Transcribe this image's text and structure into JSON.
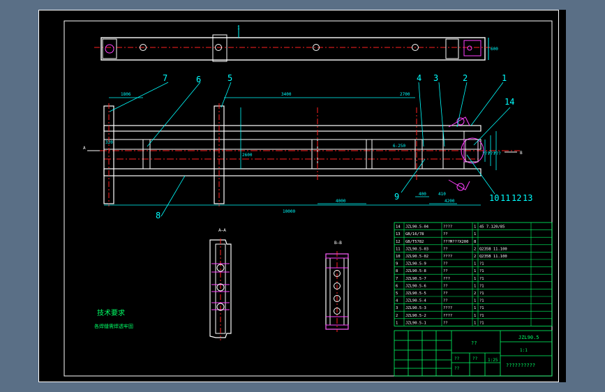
{
  "callouts": [
    "1",
    "2",
    "3",
    "4",
    "5",
    "6",
    "7",
    "8",
    "9",
    "10",
    "11",
    "12",
    "13",
    "14"
  ],
  "dimensions": {
    "top_view": "1",
    "side_height": "600",
    "dim_1806": "1806",
    "dim_3400": "3400",
    "dim_2700": "2700",
    "dim_2600": "2600",
    "dim_10000": "10000",
    "dim_4000": "4000",
    "dim_400": "400",
    "dim_410": "410",
    "dim_4200": "4200",
    "note_6_250": "6-250",
    "mark_320": "320",
    "right_dims": [
      "???",
      "???",
      "???"
    ]
  },
  "views": {
    "section_a": "A—A",
    "section_b": "B—B",
    "arrow_a": "A",
    "arrow_b": "B"
  },
  "notes": {
    "title": "技术要求",
    "line1": "各焊缝需焊透牢固"
  },
  "bom": [
    {
      "no": "14",
      "code": "JZL90.5-04",
      "name": "????",
      "qty": "1",
      "mat": "45 7.120/85"
    },
    {
      "no": "13",
      "code": "GB/16/78",
      "name": "??",
      "qty": "1",
      "mat": ""
    },
    {
      "no": "12",
      "code": "GB/T5782",
      "name": "???M???X200",
      "qty": "8",
      "mat": ""
    },
    {
      "no": "11",
      "code": "JZL90.5-03",
      "name": "??",
      "qty": "2",
      "mat": "Q235B 11.100"
    },
    {
      "no": "10",
      "code": "JZL90.5-02",
      "name": "????",
      "qty": "2",
      "mat": "Q235B 11.100"
    },
    {
      "no": "9",
      "code": "JZL90.5-9",
      "name": "??",
      "qty": "1",
      "mat": "?1"
    },
    {
      "no": "8",
      "code": "JZL90.5-8",
      "name": "??",
      "qty": "1",
      "mat": "?1"
    },
    {
      "no": "7",
      "code": "JZL90.5-7",
      "name": "???",
      "qty": "1",
      "mat": "?1"
    },
    {
      "no": "6",
      "code": "JZL90.5-6",
      "name": "??",
      "qty": "1",
      "mat": "?1"
    },
    {
      "no": "5",
      "code": "JZL90.5-5",
      "name": "??",
      "qty": "2",
      "mat": "?1"
    },
    {
      "no": "4",
      "code": "JZL90.5-4",
      "name": "??",
      "qty": "1",
      "mat": "?1"
    },
    {
      "no": "3",
      "code": "JZL90.5-3",
      "name": "????",
      "qty": "1",
      "mat": "?1"
    },
    {
      "no": "2",
      "code": "JZL90.5-2",
      "name": "????",
      "qty": "1",
      "mat": "?1"
    },
    {
      "no": "1",
      "code": "JZL90.5-1",
      "name": "??",
      "qty": "1",
      "mat": "?1"
    }
  ],
  "title_block": {
    "drawing_no": "JZL90.5",
    "name": "??",
    "scale": "1:1",
    "company": "??????????",
    "ratio": "1:25",
    "header_a": "??",
    "header_b": "??",
    "header_c": "??"
  }
}
